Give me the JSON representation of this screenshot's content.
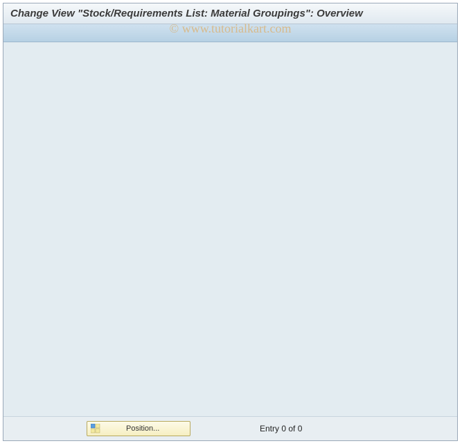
{
  "window": {
    "title": "Change View \"Stock/Requirements List: Material Groupings\": Overview"
  },
  "watermark": {
    "text": "© www.tutorialkart.com"
  },
  "footer": {
    "position_button_label": "Position...",
    "entry_status": "Entry 0 of 0"
  }
}
